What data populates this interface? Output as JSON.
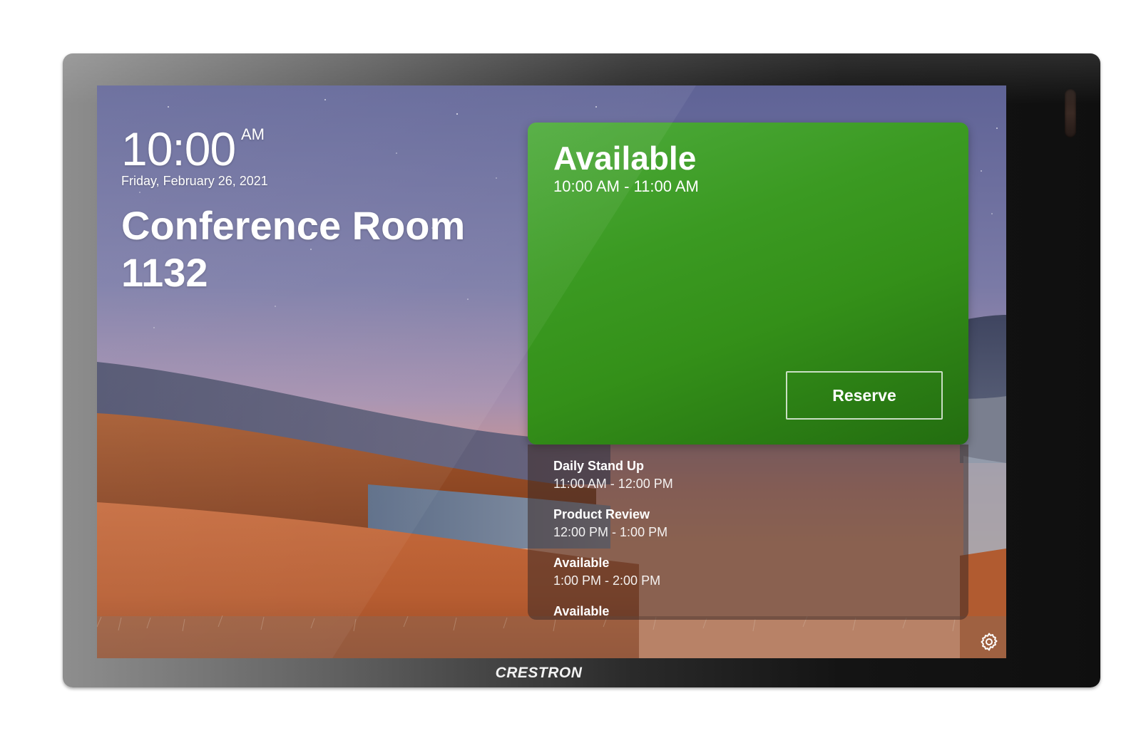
{
  "device": {
    "brand": "CRESTRON"
  },
  "clock": {
    "time": "10:00",
    "ampm": "AM",
    "date": "Friday, February 26, 2021"
  },
  "room": {
    "name": "Conference Room 1132"
  },
  "current": {
    "status": "Available",
    "time_range": "10:00 AM - 11:00 AM",
    "reserve_label": "Reserve",
    "color": "#3b9a22"
  },
  "schedule": [
    {
      "title": "Daily Stand Up",
      "time": "11:00 AM - 12:00 PM"
    },
    {
      "title": "Product Review",
      "time": "12:00 PM - 1:00 PM"
    },
    {
      "title": "Available",
      "time": "1:00 PM - 2:00 PM"
    },
    {
      "title": "Available",
      "time": ""
    }
  ],
  "icons": {
    "settings": "gear-icon"
  }
}
